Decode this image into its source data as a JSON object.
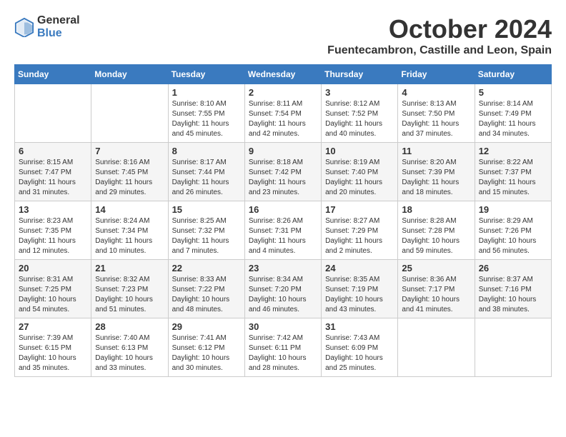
{
  "header": {
    "logo_general": "General",
    "logo_blue": "Blue",
    "month_title": "October 2024",
    "location": "Fuentecambron, Castille and Leon, Spain"
  },
  "days_of_week": [
    "Sunday",
    "Monday",
    "Tuesday",
    "Wednesday",
    "Thursday",
    "Friday",
    "Saturday"
  ],
  "weeks": [
    [
      {
        "day": "",
        "info": ""
      },
      {
        "day": "",
        "info": ""
      },
      {
        "day": "1",
        "info": "Sunrise: 8:10 AM\nSunset: 7:55 PM\nDaylight: 11 hours and 45 minutes."
      },
      {
        "day": "2",
        "info": "Sunrise: 8:11 AM\nSunset: 7:54 PM\nDaylight: 11 hours and 42 minutes."
      },
      {
        "day": "3",
        "info": "Sunrise: 8:12 AM\nSunset: 7:52 PM\nDaylight: 11 hours and 40 minutes."
      },
      {
        "day": "4",
        "info": "Sunrise: 8:13 AM\nSunset: 7:50 PM\nDaylight: 11 hours and 37 minutes."
      },
      {
        "day": "5",
        "info": "Sunrise: 8:14 AM\nSunset: 7:49 PM\nDaylight: 11 hours and 34 minutes."
      }
    ],
    [
      {
        "day": "6",
        "info": "Sunrise: 8:15 AM\nSunset: 7:47 PM\nDaylight: 11 hours and 31 minutes."
      },
      {
        "day": "7",
        "info": "Sunrise: 8:16 AM\nSunset: 7:45 PM\nDaylight: 11 hours and 29 minutes."
      },
      {
        "day": "8",
        "info": "Sunrise: 8:17 AM\nSunset: 7:44 PM\nDaylight: 11 hours and 26 minutes."
      },
      {
        "day": "9",
        "info": "Sunrise: 8:18 AM\nSunset: 7:42 PM\nDaylight: 11 hours and 23 minutes."
      },
      {
        "day": "10",
        "info": "Sunrise: 8:19 AM\nSunset: 7:40 PM\nDaylight: 11 hours and 20 minutes."
      },
      {
        "day": "11",
        "info": "Sunrise: 8:20 AM\nSunset: 7:39 PM\nDaylight: 11 hours and 18 minutes."
      },
      {
        "day": "12",
        "info": "Sunrise: 8:22 AM\nSunset: 7:37 PM\nDaylight: 11 hours and 15 minutes."
      }
    ],
    [
      {
        "day": "13",
        "info": "Sunrise: 8:23 AM\nSunset: 7:35 PM\nDaylight: 11 hours and 12 minutes."
      },
      {
        "day": "14",
        "info": "Sunrise: 8:24 AM\nSunset: 7:34 PM\nDaylight: 11 hours and 10 minutes."
      },
      {
        "day": "15",
        "info": "Sunrise: 8:25 AM\nSunset: 7:32 PM\nDaylight: 11 hours and 7 minutes."
      },
      {
        "day": "16",
        "info": "Sunrise: 8:26 AM\nSunset: 7:31 PM\nDaylight: 11 hours and 4 minutes."
      },
      {
        "day": "17",
        "info": "Sunrise: 8:27 AM\nSunset: 7:29 PM\nDaylight: 11 hours and 2 minutes."
      },
      {
        "day": "18",
        "info": "Sunrise: 8:28 AM\nSunset: 7:28 PM\nDaylight: 10 hours and 59 minutes."
      },
      {
        "day": "19",
        "info": "Sunrise: 8:29 AM\nSunset: 7:26 PM\nDaylight: 10 hours and 56 minutes."
      }
    ],
    [
      {
        "day": "20",
        "info": "Sunrise: 8:31 AM\nSunset: 7:25 PM\nDaylight: 10 hours and 54 minutes."
      },
      {
        "day": "21",
        "info": "Sunrise: 8:32 AM\nSunset: 7:23 PM\nDaylight: 10 hours and 51 minutes."
      },
      {
        "day": "22",
        "info": "Sunrise: 8:33 AM\nSunset: 7:22 PM\nDaylight: 10 hours and 48 minutes."
      },
      {
        "day": "23",
        "info": "Sunrise: 8:34 AM\nSunset: 7:20 PM\nDaylight: 10 hours and 46 minutes."
      },
      {
        "day": "24",
        "info": "Sunrise: 8:35 AM\nSunset: 7:19 PM\nDaylight: 10 hours and 43 minutes."
      },
      {
        "day": "25",
        "info": "Sunrise: 8:36 AM\nSunset: 7:17 PM\nDaylight: 10 hours and 41 minutes."
      },
      {
        "day": "26",
        "info": "Sunrise: 8:37 AM\nSunset: 7:16 PM\nDaylight: 10 hours and 38 minutes."
      }
    ],
    [
      {
        "day": "27",
        "info": "Sunrise: 7:39 AM\nSunset: 6:15 PM\nDaylight: 10 hours and 35 minutes."
      },
      {
        "day": "28",
        "info": "Sunrise: 7:40 AM\nSunset: 6:13 PM\nDaylight: 10 hours and 33 minutes."
      },
      {
        "day": "29",
        "info": "Sunrise: 7:41 AM\nSunset: 6:12 PM\nDaylight: 10 hours and 30 minutes."
      },
      {
        "day": "30",
        "info": "Sunrise: 7:42 AM\nSunset: 6:11 PM\nDaylight: 10 hours and 28 minutes."
      },
      {
        "day": "31",
        "info": "Sunrise: 7:43 AM\nSunset: 6:09 PM\nDaylight: 10 hours and 25 minutes."
      },
      {
        "day": "",
        "info": ""
      },
      {
        "day": "",
        "info": ""
      }
    ]
  ]
}
